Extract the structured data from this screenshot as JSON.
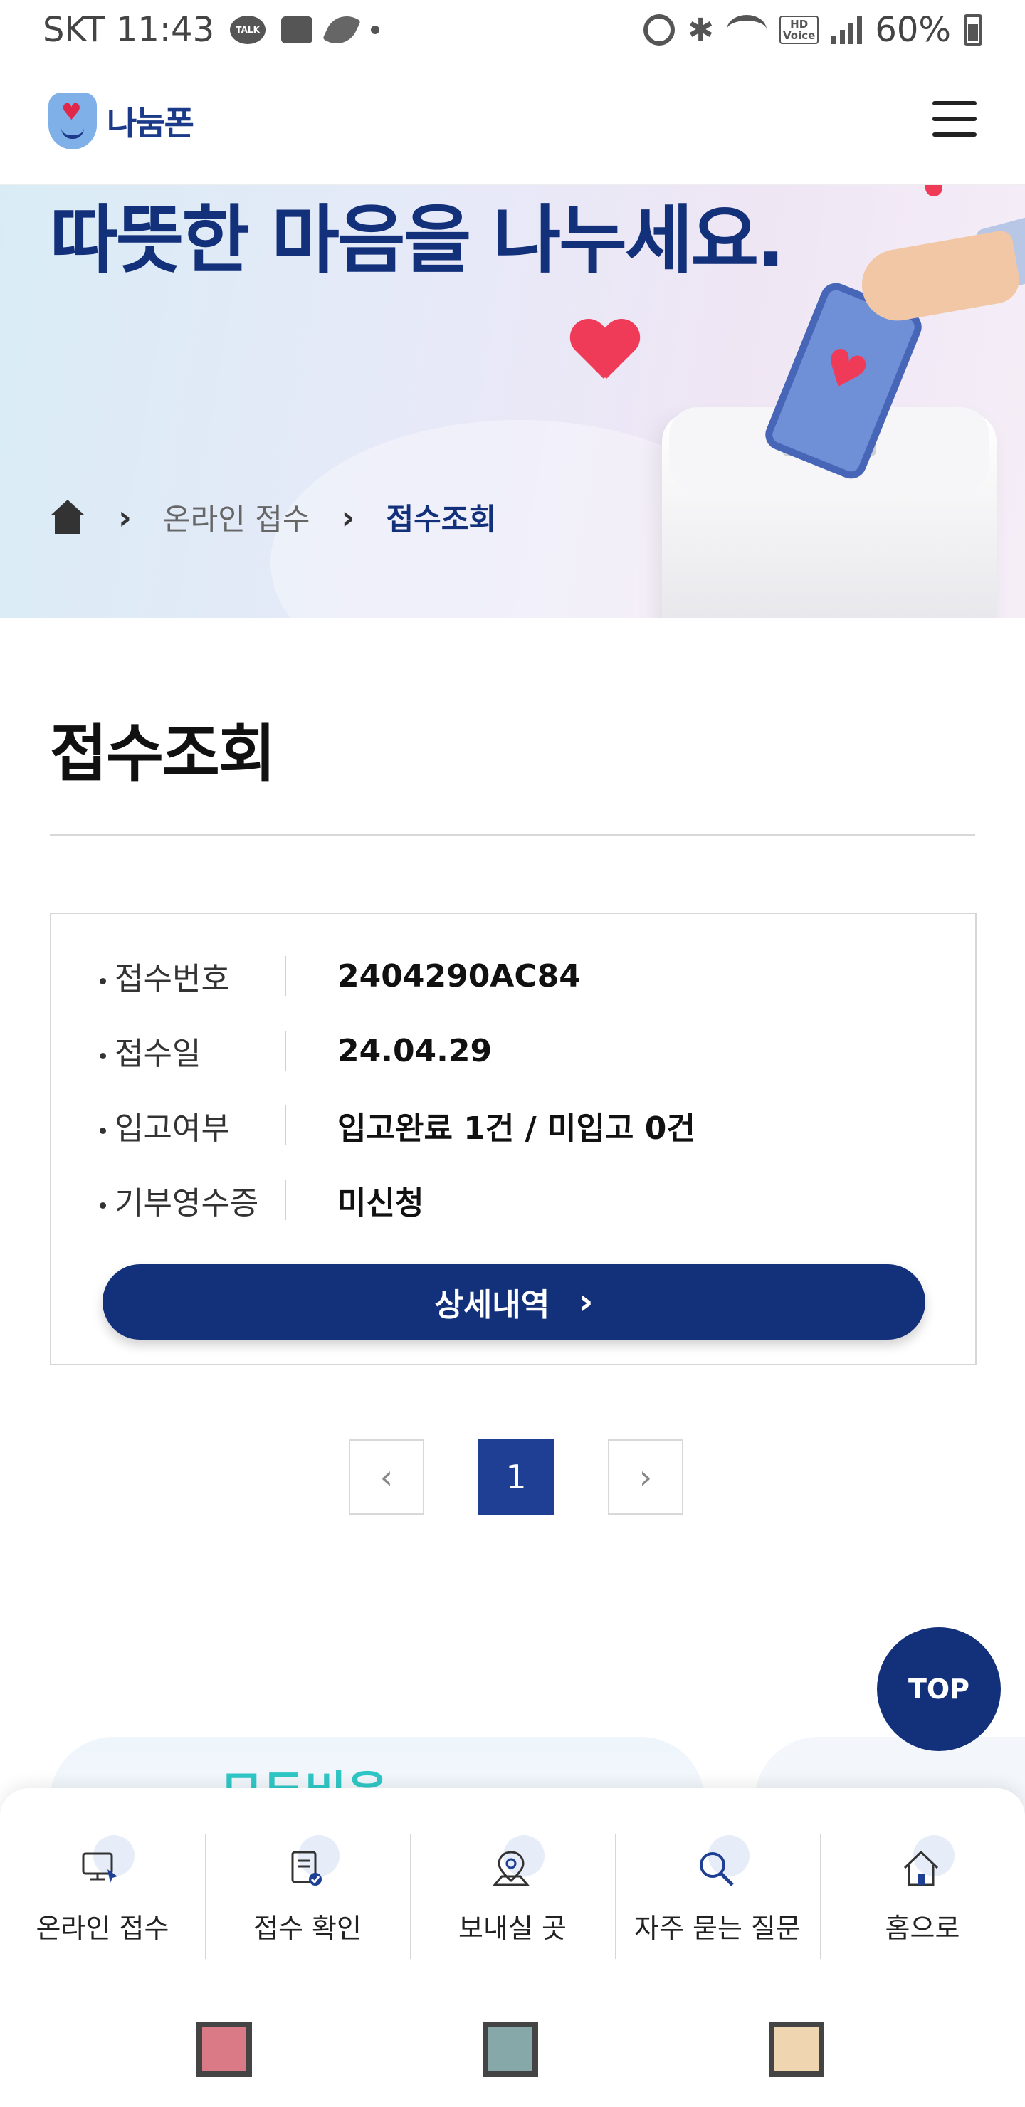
{
  "status_bar": {
    "carrier_time": "SKT 11:43",
    "talk_badge": "TALK",
    "hd_label": "HD\nVoice",
    "battery": "60%"
  },
  "header": {
    "logo_text": "나눔폰"
  },
  "hero": {
    "title": "따뜻한 마음을 나누세요."
  },
  "breadcrumb": {
    "level1": "온라인 접수",
    "current": "접수조회"
  },
  "page": {
    "title": "접수조회"
  },
  "receipt": {
    "rows": [
      {
        "label": "접수번호",
        "value": "2404290AC84"
      },
      {
        "label": "접수일",
        "value": "24.04.29"
      },
      {
        "label": "입고여부",
        "value": "입고완료 1건 / 미입고 0건"
      },
      {
        "label": "기부영수증",
        "value": "미신청"
      }
    ],
    "detail_button": "상세내역"
  },
  "pagination": {
    "current_page": "1"
  },
  "top_button": "TOP",
  "banner_text": "모두비움",
  "bottom_nav": [
    {
      "label": "온라인 접수",
      "icon": "monitor-click-icon"
    },
    {
      "label": "접수 확인",
      "icon": "clipboard-check-icon"
    },
    {
      "label": "보내실 곳",
      "icon": "map-pin-icon"
    },
    {
      "label": "자주 묻는 질문",
      "icon": "magnifier-icon"
    },
    {
      "label": "홈으로",
      "icon": "home-icon"
    }
  ],
  "system_nav_colors": [
    "#d97a86",
    "#86a8a8",
    "#efd5b0"
  ],
  "colors": {
    "brand_navy": "#13317a",
    "accent_red": "#ef3b58"
  }
}
